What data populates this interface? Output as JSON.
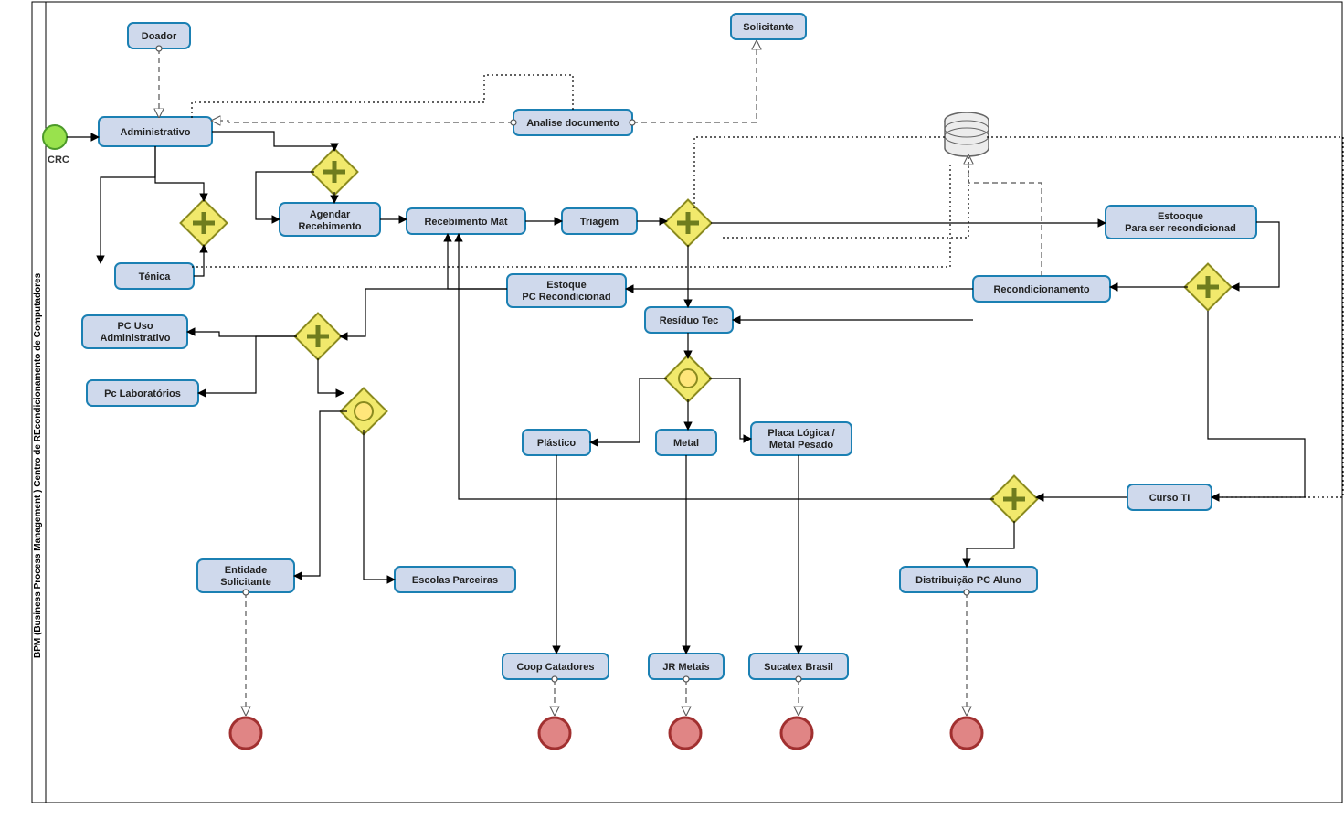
{
  "pool": {
    "title": "BPM (Business Process Management )  Centro de REcondicionamento de Computadores",
    "startLabel": "CRC"
  },
  "tasks": {
    "doador": "Doador",
    "solicitante": "Solicitante",
    "administrativo": "Administrativo",
    "tecnica": "Ténica",
    "agendar": "Agendar\nRecebimento",
    "analise": "Analise documento",
    "recebMat": "Recebimento Mat",
    "triagem": "Triagem",
    "estoqueReco": "Estooque\nPara ser recondicionad",
    "estoquePC": "Estoque\nPC Recondicionad",
    "recondicionamento": "Recondicionamento",
    "residuo": "Resíduo Tec",
    "pcUso": "PC Uso\nAdministrativo",
    "pcLab": "Pc Laboratórios",
    "plastico": "Plástico",
    "metal": "Metal",
    "placa": "Placa Lógica /\nMetal Pesado",
    "curso": "Curso  TI",
    "entSolic": "Entidade\nSolicitante",
    "escolas": "Escolas Parceiras",
    "coop": "Coop Catadores",
    "jr": "JR Metais",
    "sucatex": "Sucatex Brasil",
    "distAluno": "Distribuição PC Aluno"
  }
}
